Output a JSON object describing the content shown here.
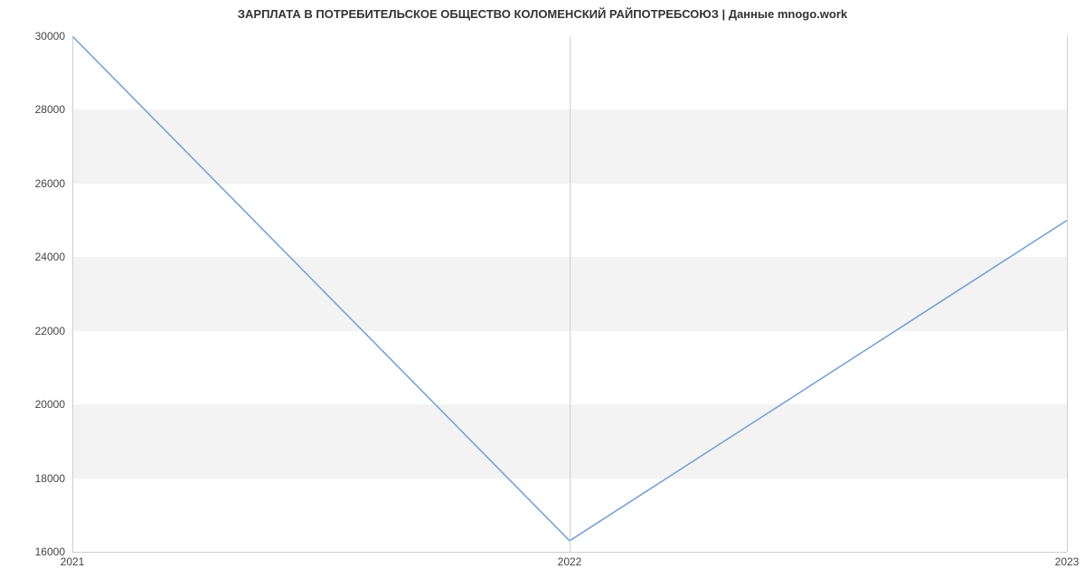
{
  "chart_data": {
    "type": "line",
    "title": "ЗАРПЛАТА В ПОТРЕБИТЕЛЬСКОЕ ОБЩЕСТВО КОЛОМЕНСКИЙ РАЙПОТРЕБСОЮЗ | Данные mnogo.work",
    "xlabel": "",
    "ylabel": "",
    "x": [
      2021,
      2022,
      2023
    ],
    "values": [
      30000,
      16300,
      25000
    ],
    "x_ticks": [
      2021,
      2022,
      2023
    ],
    "y_ticks": [
      16000,
      18000,
      20000,
      22000,
      24000,
      26000,
      28000,
      30000
    ],
    "ylim": [
      16000,
      30000
    ],
    "xlim": [
      2021,
      2023
    ],
    "series_color": "#6f9ed8",
    "band_color": "#f3f3f3"
  }
}
